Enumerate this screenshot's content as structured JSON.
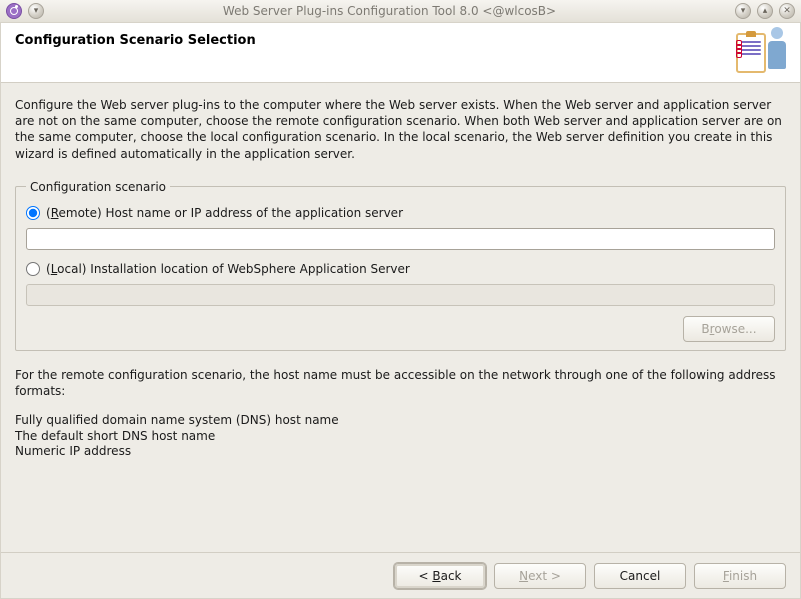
{
  "window": {
    "title": "Web Server Plug-ins Configuration Tool 8.0  <@wlcosB>"
  },
  "header": {
    "title": "Configuration Scenario Selection"
  },
  "intro": "Configure the Web server plug-ins to the computer where the Web server exists. When the Web server and application server are not on the same computer, choose the remote configuration scenario. When both Web server and application server are on the same computer, choose the local configuration scenario. In the local scenario, the Web server definition you create in this wizard is defined automatically in the application server.",
  "group": {
    "legend": "Configuration scenario",
    "remote": {
      "prefix": "(",
      "mnemonic": "R",
      "rest": "emote) Host name or IP address of the application server",
      "value": ""
    },
    "local": {
      "prefix": "(",
      "mnemonic": "L",
      "rest": "ocal) Installation location of WebSphere Application Server",
      "value": ""
    },
    "browse_prefix": "B",
    "browse_mnemonic": "r",
    "browse_rest": "owse..."
  },
  "footnote": "For the remote configuration scenario, the host name must be accessible on the network through one of the following address formats:",
  "formats": {
    "a": "Fully qualified domain name system (DNS) host name",
    "b": "The default short DNS host name",
    "c": "Numeric IP address"
  },
  "footer": {
    "back_prefix": "< ",
    "back_mnemonic": "B",
    "back_rest": "ack",
    "next_mnemonic": "N",
    "next_rest": "ext >",
    "cancel": "Cancel",
    "finish_mnemonic": "F",
    "finish_rest": "inish"
  }
}
